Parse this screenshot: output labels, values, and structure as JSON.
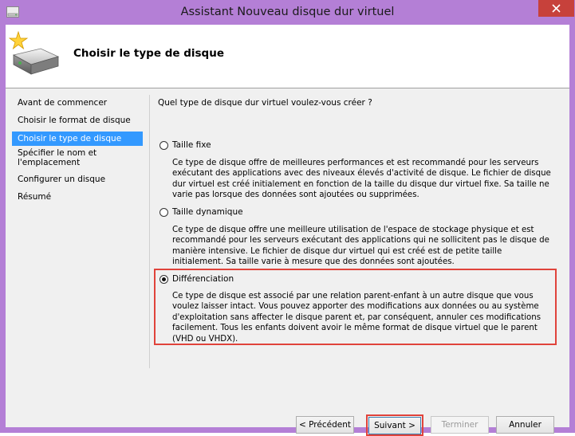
{
  "window": {
    "title": "Assistant Nouveau disque dur virtuel",
    "close_glyph": "✕",
    "accent_color": "#b47fd6",
    "close_color": "#c7413b"
  },
  "header": {
    "title": "Choisir le type de disque",
    "icon": "hard-disk-new-icon"
  },
  "nav": {
    "items": [
      {
        "label": "Avant de commencer",
        "active": false
      },
      {
        "label": "Choisir le format de disque",
        "active": false
      },
      {
        "label": "Choisir le type de disque",
        "active": true
      },
      {
        "label": "Spécifier le nom et l'emplacement",
        "active": false
      },
      {
        "label": "Configurer un disque",
        "active": false
      },
      {
        "label": "Résumé",
        "active": false
      }
    ]
  },
  "main": {
    "question": "Quel type de disque dur virtuel voulez-vous créer ?",
    "options": [
      {
        "label": "Taille fixe",
        "checked": false,
        "description": "Ce type de disque offre de meilleures performances et est recommandé pour les serveurs exécutant des applications avec des niveaux élevés d'activité de disque. Le fichier de disque dur virtuel est créé initialement en fonction de la taille du disque dur virtuel fixe. Sa taille ne varie pas lorsque des données sont ajoutées ou supprimées."
      },
      {
        "label": "Taille dynamique",
        "checked": false,
        "description": "Ce type de disque offre une meilleure utilisation de l'espace de stockage physique et est recommandé pour les serveurs exécutant des applications qui ne sollicitent pas le disque de manière intensive. Le fichier de disque dur virtuel qui est créé est de petite taille initialement. Sa taille varie à mesure que des données sont ajoutées."
      },
      {
        "label": "Différenciation",
        "checked": true,
        "description": "Ce type de disque est associé par une relation parent-enfant à un autre disque que vous voulez laisser intact. Vous pouvez apporter des modifications aux données ou au système d'exploitation sans affecter le disque parent et, par conséquent, annuler ces modifications facilement. Tous les enfants doivent avoir le même format de disque virtuel que le parent (VHD ou VHDX)."
      }
    ]
  },
  "buttons": {
    "previous": "< Précédent",
    "next": "Suivant >",
    "finish": "Terminer",
    "cancel": "Annuler"
  },
  "highlight_color": "#e0433b"
}
